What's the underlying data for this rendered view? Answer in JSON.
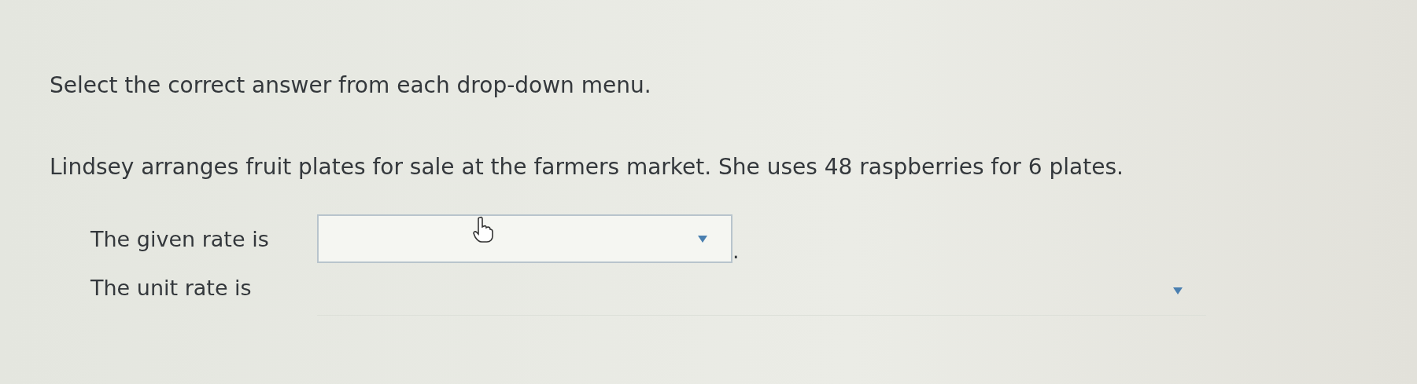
{
  "instruction": "Select the correct answer from each drop-down menu.",
  "problem": "Lindsey arranges fruit plates for sale at the farmers market. She uses 48 raspberries for 6 plates.",
  "questions": [
    {
      "label": "The given rate is",
      "after": "."
    },
    {
      "label": "The unit rate is"
    }
  ]
}
